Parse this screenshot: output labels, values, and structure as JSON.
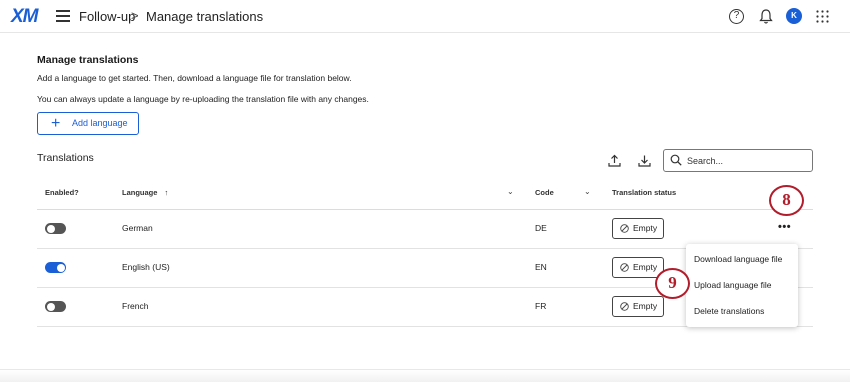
{
  "app": {
    "logo": "XM",
    "breadcrumb": {
      "parent": "Follow-up",
      "separator": ">",
      "current": "Manage translations"
    },
    "user_initial": "K"
  },
  "page": {
    "title": "Manage translations",
    "intro_line1": "Add a language to get started. Then, download a language file for translation below.",
    "intro_line2": "You can always update a language by re-uploading the translation file with any changes.",
    "add_button": "Add language",
    "section_title": "Translations",
    "search_placeholder": "Search..."
  },
  "table": {
    "columns": {
      "enabled": "Enabled?",
      "language": "Language",
      "language_sort": "↑",
      "code": "Code",
      "status": "Translation status"
    },
    "rows": [
      {
        "enabled": false,
        "language": "German",
        "code": "DE",
        "status": "Empty"
      },
      {
        "enabled": true,
        "language": "English (US)",
        "code": "EN",
        "status": "Empty"
      },
      {
        "enabled": false,
        "language": "French",
        "code": "FR",
        "status": "Empty"
      }
    ]
  },
  "menu": {
    "items": [
      "Download language file",
      "Upload language file",
      "Delete translations"
    ]
  },
  "callouts": {
    "first": "8",
    "second": "9"
  },
  "colors": {
    "brand": "#1a5fd6",
    "callout": "#b21d2b",
    "toggle_off": "#555555"
  },
  "icons": [
    "hamburger-icon",
    "help-icon",
    "bell-icon",
    "apps-grid-icon",
    "plus-icon",
    "upload-icon",
    "download-icon",
    "search-icon",
    "sort-arrow-icon",
    "chevron-down-icon",
    "ban-icon",
    "more-icon"
  ]
}
